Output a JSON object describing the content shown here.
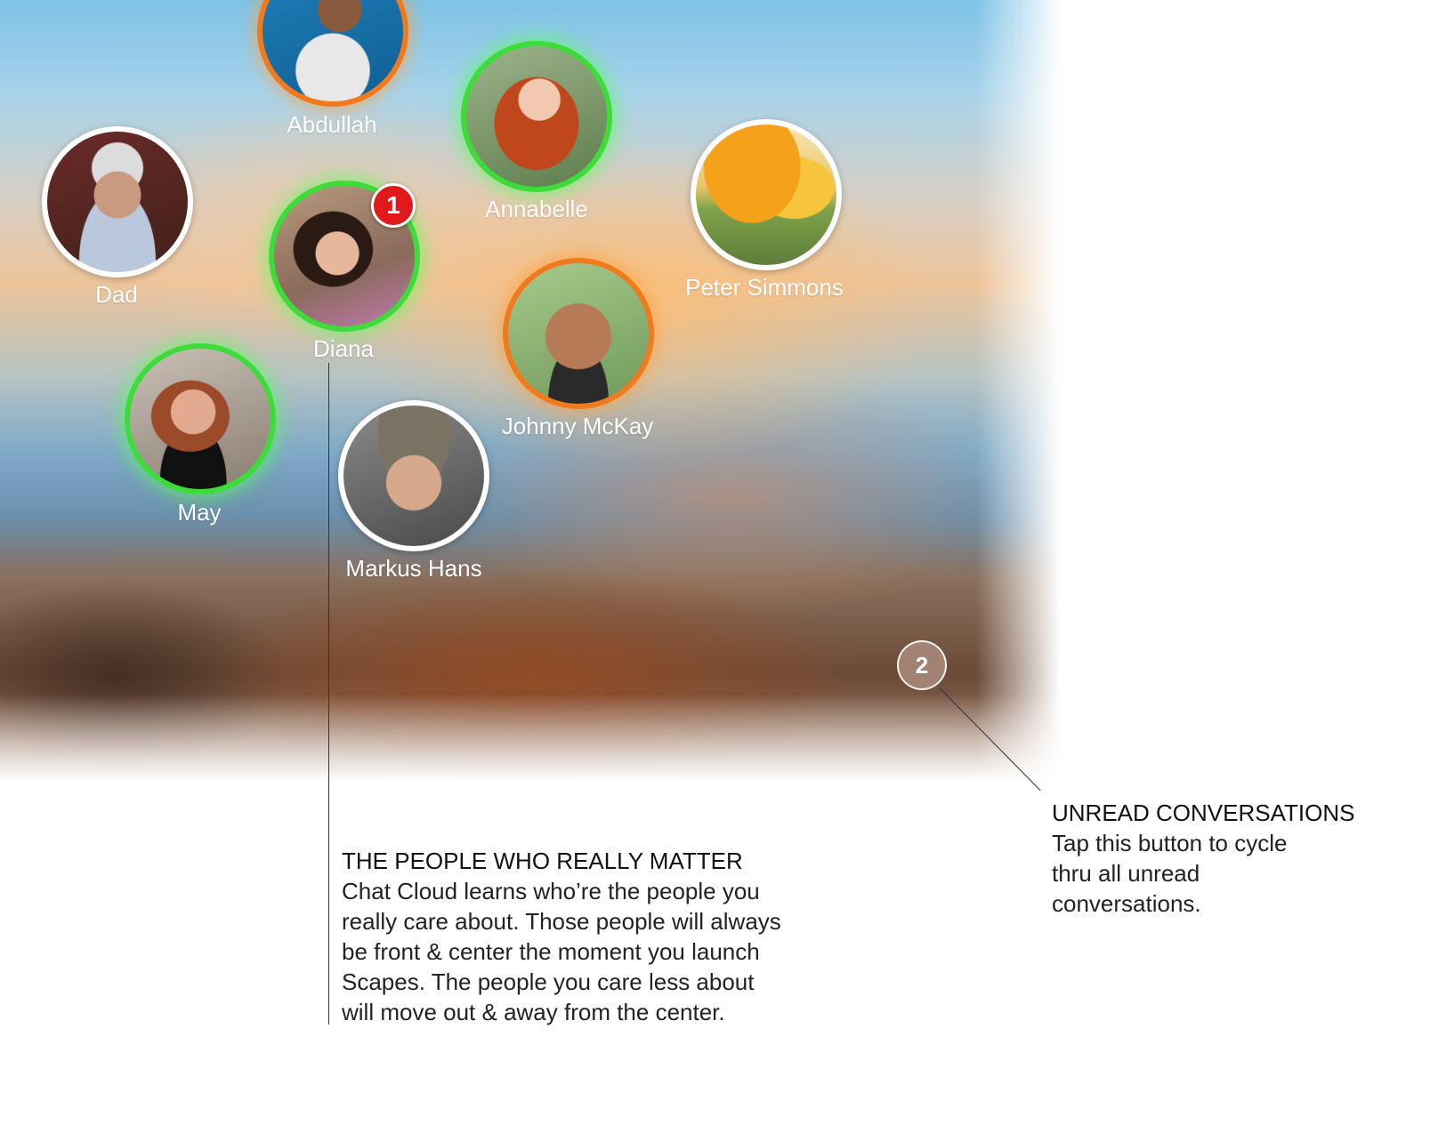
{
  "contacts": [
    {
      "id": "abdullah",
      "name": "Abdullah",
      "ring": "orange"
    },
    {
      "id": "annabelle",
      "name": "Annabelle",
      "ring": "green"
    },
    {
      "id": "dad",
      "name": "Dad",
      "ring": "white"
    },
    {
      "id": "diana",
      "name": "Diana",
      "ring": "green",
      "badge": "1"
    },
    {
      "id": "peter",
      "name": "Peter Simmons",
      "ring": "white"
    },
    {
      "id": "johnny",
      "name": "Johnny McKay",
      "ring": "orange"
    },
    {
      "id": "may",
      "name": "May",
      "ring": "green"
    },
    {
      "id": "markus",
      "name": "Markus Hans",
      "ring": "white"
    }
  ],
  "unread_button": {
    "count": "2"
  },
  "callouts": {
    "people": {
      "title": "THE PEOPLE WHO REALLY MATTER",
      "lines": [
        "Chat Cloud learns who’re the people you",
        "really care about. Those people will always",
        "be front & center the moment you launch",
        "Scapes. The people you care less about",
        "will move out & away from the center."
      ]
    },
    "unread": {
      "title": "UNREAD CONVERSATIONS",
      "lines": [
        "Tap this button to cycle",
        "thru all unread",
        "conversations."
      ]
    }
  },
  "colors": {
    "ring_green": "#3ddc3a",
    "ring_orange": "#f07a1e",
    "badge_red": "#e01a1a"
  }
}
